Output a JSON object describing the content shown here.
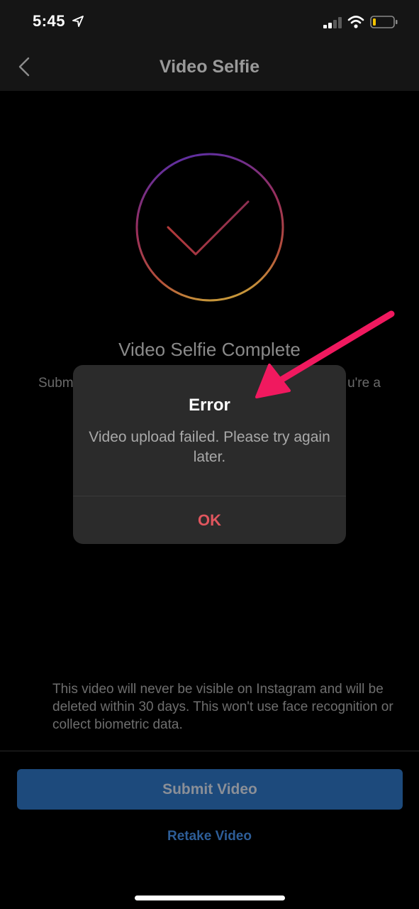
{
  "status_bar": {
    "time": "5:45"
  },
  "nav": {
    "title": "Video Selfie"
  },
  "content": {
    "complete_title": "Video Selfie Complete",
    "body_left": "Subm",
    "body_right": "u're a",
    "disclaimer": "This video will never be visible on Instagram and will be deleted within 30 days. This won't use face recognition or collect biometric data."
  },
  "actions": {
    "submit_label": "Submit Video",
    "retake_label": "Retake Video"
  },
  "dialog": {
    "title": "Error",
    "message": "Video upload failed. Please try again later.",
    "ok_label": "OK"
  },
  "colors": {
    "accent_blue": "#1d4a7c",
    "link_blue": "#2d5d97",
    "dialog_ok": "#e0565e",
    "annotation_arrow": "#f0195f"
  }
}
